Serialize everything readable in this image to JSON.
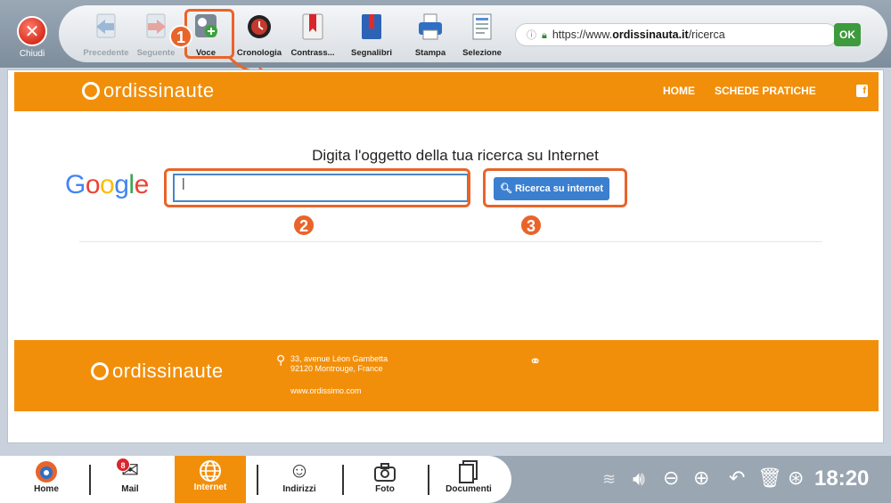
{
  "toolbar": {
    "close_label": "Chiudi",
    "tools": [
      {
        "label": "Precedente",
        "icon": "back-arrow-icon"
      },
      {
        "label": "Seguente",
        "icon": "forward-arrow-icon"
      },
      {
        "label": "Voce",
        "icon": "voice-add-icon"
      },
      {
        "label": "Cronologia",
        "icon": "clock-history-icon"
      },
      {
        "label": "Contrass...",
        "icon": "bookmark-red-icon"
      },
      {
        "label": "Segnalibri",
        "icon": "bookmarks-book-icon"
      },
      {
        "label": "Stampa",
        "icon": "printer-icon"
      },
      {
        "label": "Selezione",
        "icon": "selection-document-icon"
      }
    ],
    "url_prefix": "https://www.",
    "url_host": "ordissinauta.it",
    "url_path": "/ricerca",
    "ok_label": "OK"
  },
  "annotations": {
    "badge1": "1",
    "badge2": "2",
    "badge3": "3",
    "color": "#e9642a"
  },
  "site": {
    "logo_text": "ordissinaute",
    "nav": {
      "home": "HOME",
      "schede": "SCHEDE PRATICHE"
    },
    "search_title": "Digita l'oggetto della tua ricerca su Internet",
    "google_text": "Google",
    "search_value": "",
    "search_button": "Ricerca su internet",
    "footer_address_1": "33, avenue Léon Gambetta",
    "footer_address_2": "92120 Montrouge, France",
    "footer_web": "www.ordissimo.com",
    "brand_color": "#f28f0a"
  },
  "dock": {
    "items": [
      {
        "label": "Home",
        "icon": "home-logo-icon"
      },
      {
        "label": "Mail",
        "icon": "mail-envelope-icon",
        "badge": "8"
      },
      {
        "label": "Internet",
        "icon": "globe-icon"
      },
      {
        "label": "Indirizzi",
        "icon": "contacts-icon"
      },
      {
        "label": "Foto",
        "icon": "camera-icon"
      },
      {
        "label": "Documenti",
        "icon": "documents-icon"
      }
    ],
    "clock": "18:20"
  }
}
